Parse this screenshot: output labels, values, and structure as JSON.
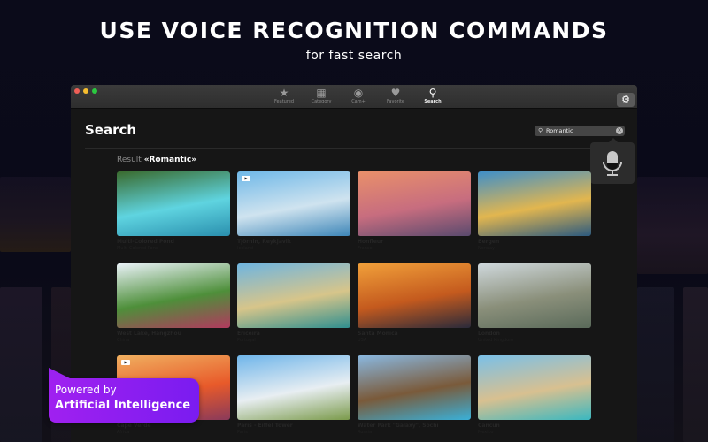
{
  "promo": {
    "headline": "USE VOICE RECOGNITION COMMANDS",
    "subline": "for fast search",
    "badge_line1": "Powered by",
    "badge_line2": "Artificial Intelligence",
    "badge_color": "#9b22f0"
  },
  "window": {
    "tabs": [
      {
        "label": "Featured",
        "icon": "star-icon",
        "glyph": "★"
      },
      {
        "label": "Category",
        "icon": "grid-icon",
        "glyph": "▦"
      },
      {
        "label": "Cam+",
        "icon": "webcam-icon",
        "glyph": "◉"
      },
      {
        "label": "Favorite",
        "icon": "heart-icon",
        "glyph": "♥"
      },
      {
        "label": "Search",
        "icon": "search-icon",
        "glyph": "⚲"
      }
    ],
    "active_tab": "Search",
    "settings_glyph": "⚙"
  },
  "page": {
    "title": "Search",
    "search_value": "Romantic",
    "result_prefix": "Result",
    "result_query": "«Romantic»"
  },
  "results": [
    {
      "title": "Multi-Colored Pond",
      "subtitle": "Multi-Colored Pond",
      "video": false,
      "colors": [
        "#3a6b2e",
        "#5fd4e0",
        "#2a8fae"
      ]
    },
    {
      "title": "Tjörnin, Reykjavik",
      "subtitle": "Iceland",
      "video": true,
      "colors": [
        "#6fb8e8",
        "#cfe3ef",
        "#3e86b8"
      ]
    },
    {
      "title": "Honfleur",
      "subtitle": "France",
      "video": false,
      "colors": [
        "#e9906a",
        "#c76d7f",
        "#5a4a6e"
      ]
    },
    {
      "title": "Bergen",
      "subtitle": "Norway",
      "video": false,
      "colors": [
        "#3f8fc9",
        "#e2b64f",
        "#2c5a7f"
      ]
    },
    {
      "title": "West Lake, Hangzhou",
      "subtitle": "China",
      "video": false,
      "colors": [
        "#eaf2f8",
        "#4e8f3a",
        "#b13a5e"
      ]
    },
    {
      "title": "Ericeira",
      "subtitle": "Portugal",
      "video": false,
      "colors": [
        "#6fb5e0",
        "#d7c58a",
        "#2f8f8f"
      ]
    },
    {
      "title": "Santa Monica",
      "subtitle": "USA",
      "video": false,
      "colors": [
        "#f1a03a",
        "#c45a1e",
        "#2a2a3a"
      ]
    },
    {
      "title": "London",
      "subtitle": "United Kingdom",
      "video": false,
      "colors": [
        "#cfd8dc",
        "#8a8f7a",
        "#5a6a5a"
      ]
    },
    {
      "title": "Cape Verde",
      "subtitle": "Africa",
      "video": true,
      "colors": [
        "#f0b060",
        "#e85a2a",
        "#8a3a5a"
      ]
    },
    {
      "title": "Paris - Eiffel Tower",
      "subtitle": "Paris",
      "video": false,
      "colors": [
        "#6fb5ea",
        "#e8eef2",
        "#7a9a4a"
      ]
    },
    {
      "title": "Water Park \"Galaxy\", Sochi",
      "subtitle": "Russia",
      "video": false,
      "colors": [
        "#8ab8e0",
        "#7a5a3a",
        "#3ab0d8"
      ]
    },
    {
      "title": "Cancun",
      "subtitle": "Mexico",
      "video": false,
      "colors": [
        "#7ac0e8",
        "#d8c090",
        "#3ab8c0"
      ]
    }
  ]
}
